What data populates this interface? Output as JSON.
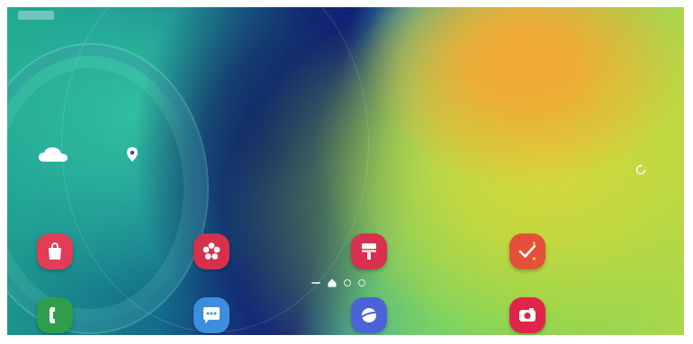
{
  "status_bar": {
    "left_text": ""
  },
  "widgets": {
    "weather_temp": "",
    "location_text": "",
    "clock_time": "",
    "clock_date": ""
  },
  "page_indicator": {
    "page_count": 3,
    "active_page": "home"
  },
  "apps_row1": [
    {
      "label": "",
      "icon": "shopping-bag-icon",
      "color": "#e23c57"
    },
    {
      "label": "",
      "icon": "flower-icon",
      "color": "#d7304c"
    },
    {
      "label": "",
      "icon": "paint-roller-icon",
      "color": "#d8304e"
    },
    {
      "label": "",
      "icon": "check-reminder-icon",
      "color": "#e5503a"
    }
  ],
  "apps_row2": [
    {
      "label": "",
      "icon": "phone-icon",
      "color": "#2f9e4b"
    },
    {
      "label": "",
      "icon": "chat-icon",
      "color": "#3b8ee0"
    },
    {
      "label": "",
      "icon": "planet-icon",
      "color": "#4a63d8"
    },
    {
      "label": "",
      "icon": "camera-icon",
      "color": "#e02648"
    }
  ],
  "colors": {
    "wallpaper_orange": "#f3a733",
    "wallpaper_navy": "#14227a",
    "wallpaper_teal": "#1fa58e"
  }
}
